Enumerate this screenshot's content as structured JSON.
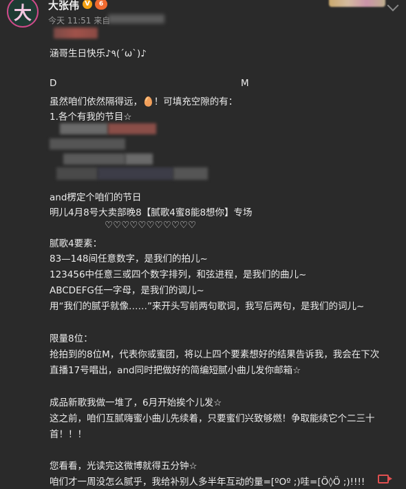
{
  "header": {
    "avatar_char": "大",
    "name": "大张伟",
    "v_badge": "V",
    "member_badge": "6",
    "time": "今天 11:51 来自"
  },
  "post": {
    "line1": "涵哥生日快乐♪٩(´ω`)♪",
    "d_label": "D",
    "m_label": "M",
    "line2": "虽然咱们依然隔得远，🥚！可填充空隙的有：",
    "line3": "1.各个有我的节目☆",
    "line4": "and楞定个咱们的节日",
    "line5": "明儿4月8号大卖部晚8【腻歌4蜜8能8想你】专场",
    "hearts": "♡♡♡♡♡♡♡♡♡♡♡",
    "line6": "腻歌4要素：",
    "line7": "83—148间任意数字，是我们的拍儿~",
    "line8": "123456中任意三或四个数字排列，和弦进程，是我们的曲儿~",
    "line9": "ABCDEFG任一字母，是我们的调儿~",
    "line10": "用“我们的腻乎就像……”来开头写前两句歌词，我写后两句，是我们的词儿~",
    "line11": "限量8位：",
    "line12": "抢拍到的8位M，代表你或蜜团，将以上四个要素想好的结果告诉我，我会在下次",
    "line13": "直播17号唱出，and同时把做好的简编短腻小曲儿发你邮箱☆",
    "line14": "成品新歌我做一堆了，6月开始挨个儿发☆",
    "line15": "这之前，咱们互腻嗨蜜小曲儿先续着，只要蜜们兴致够燃！争取能续它个二三十",
    "line16": "首！！！",
    "line17": "您看看，光读完这微博就得五分钟☆",
    "line18": "咱们才一周没怎么腻乎，我给补别人多半年互动的量=[ºOº ;)哇=[Ö◊Ö ;)!!!!"
  },
  "colors": {
    "background": "#2a2a2a",
    "text": "#ececec",
    "muted": "#9a9a9a",
    "accent_red": "#e05050"
  }
}
